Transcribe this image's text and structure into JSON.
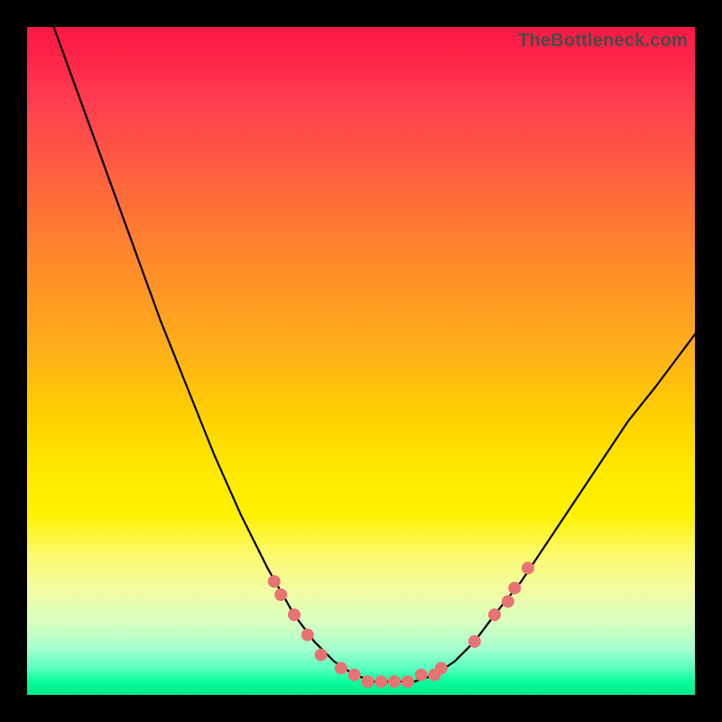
{
  "attribution": "TheBottleneck.com",
  "chart_data": {
    "type": "line",
    "title": "",
    "xlabel": "",
    "ylabel": "",
    "xlim": [
      0,
      100
    ],
    "ylim": [
      0,
      100
    ],
    "grid": false,
    "legend": false,
    "series": [
      {
        "name": "bottleneck-curve",
        "x": [
          4,
          8,
          12,
          16,
          20,
          24,
          28,
          32,
          36,
          40,
          43,
          46,
          49,
          52,
          55,
          58,
          61,
          64,
          67,
          70,
          74,
          78,
          82,
          86,
          90,
          94,
          100
        ],
        "y": [
          100,
          89,
          78,
          67,
          56,
          46,
          36,
          27,
          19,
          12,
          8,
          5,
          3,
          2,
          2,
          2,
          3,
          5,
          8,
          12,
          17,
          23,
          29,
          35,
          41,
          46,
          54
        ]
      }
    ],
    "markers": {
      "name": "highlight-dots",
      "color": "#e77373",
      "points": [
        {
          "x": 37,
          "y": 17
        },
        {
          "x": 38,
          "y": 15
        },
        {
          "x": 40,
          "y": 12
        },
        {
          "x": 42,
          "y": 9
        },
        {
          "x": 44,
          "y": 6
        },
        {
          "x": 47,
          "y": 4
        },
        {
          "x": 49,
          "y": 3
        },
        {
          "x": 51,
          "y": 2
        },
        {
          "x": 53,
          "y": 2
        },
        {
          "x": 55,
          "y": 2
        },
        {
          "x": 57,
          "y": 2
        },
        {
          "x": 59,
          "y": 3
        },
        {
          "x": 61,
          "y": 3
        },
        {
          "x": 62,
          "y": 4
        },
        {
          "x": 67,
          "y": 8
        },
        {
          "x": 70,
          "y": 12
        },
        {
          "x": 72,
          "y": 14
        },
        {
          "x": 73,
          "y": 16
        },
        {
          "x": 75,
          "y": 19
        }
      ]
    }
  }
}
